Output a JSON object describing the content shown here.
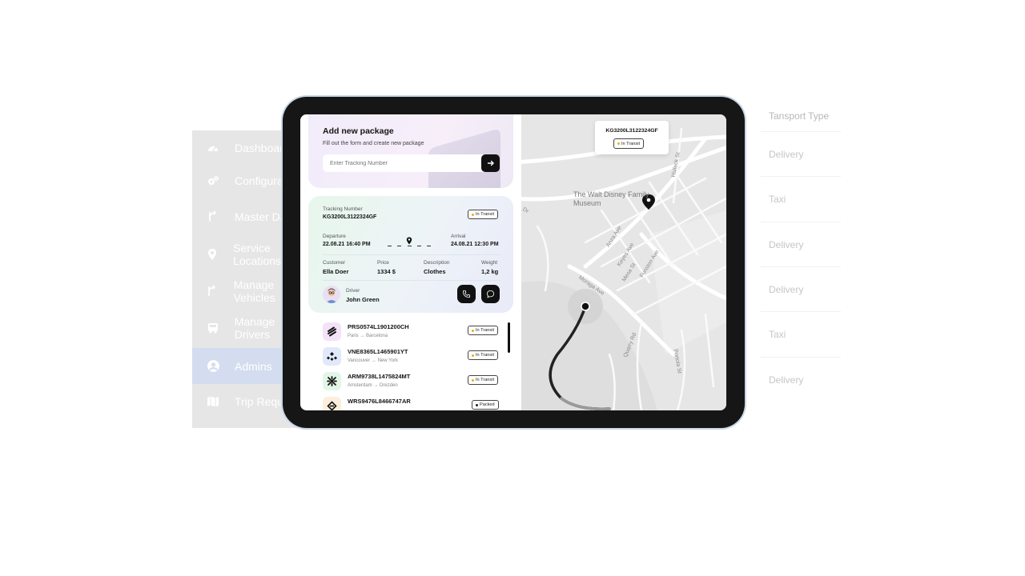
{
  "background": {
    "sidebar": {
      "items": [
        {
          "label": "Dashboard",
          "icon": "gauge-icon"
        },
        {
          "label": "Configurations",
          "icon": "gears-icon"
        },
        {
          "label": "Master Data",
          "icon": "route-icon"
        },
        {
          "label": "Service Locations",
          "icon": "location-pin-icon"
        },
        {
          "label": "Manage Vehicles",
          "icon": "route-icon"
        },
        {
          "label": "Manage Drivers",
          "icon": "bus-icon"
        },
        {
          "label": "Admins",
          "icon": "user-circle-icon",
          "active": true
        },
        {
          "label": "Trip Requests",
          "icon": "map-icon"
        }
      ]
    },
    "table": {
      "header": "Tansport Type",
      "rows": [
        "Delivery",
        "Taxi",
        "Delivery",
        "Delivery",
        "Taxi",
        "Delivery"
      ]
    }
  },
  "app": {
    "add_package": {
      "title": "Add new package",
      "subtitle": "Fill out the form and create new package",
      "placeholder": "Enter Tracking Number"
    },
    "details": {
      "tracking_label": "Tracking Number",
      "tracking_number": "KG3200L3122324GF",
      "status": "In Transit",
      "departure_label": "Departure",
      "departure": "22.08.21 16:40 PM",
      "arrival_label": "Arrival",
      "arrival": "24.08.21 12:30 PM",
      "customer_label": "Customer",
      "customer": "Ella Doer",
      "price_label": "Price",
      "price": "1334 $",
      "description_label": "Description",
      "description": "Clothes",
      "weight_label": "Weight",
      "weight": "1,2 kg",
      "driver_label": "Driver",
      "driver": "John Green"
    },
    "packages": [
      {
        "id": "PRS0574L1901200CH",
        "from": "Paris",
        "to": "Barcelona",
        "status": "In Transit",
        "color": "#f3e2f8",
        "icon": "stripes-icon"
      },
      {
        "id": "VNE8365L1465901YT",
        "from": "Vancouver",
        "to": "New York",
        "status": "In Transit",
        "color": "#e1e8f9",
        "icon": "diamond-dots-icon"
      },
      {
        "id": "ARM9738L1475824MT",
        "from": "Amsterdam",
        "to": "Drezden",
        "status": "In Transit",
        "color": "#e2f6e8",
        "icon": "cross-icon"
      },
      {
        "id": "WRS9476L8466747AR",
        "from": "",
        "to": "",
        "status": "Packed",
        "color": "#fbefdc",
        "icon": "stack-icon"
      }
    ],
    "map": {
      "tracking_number": "KG3200L3122324GF",
      "status": "In Transit",
      "place": "The Walt Disney Family Museum",
      "streets": [
        "Halleck St",
        "Anza Ave",
        "Keyes Ave",
        "Mesa St",
        "Funston Ave",
        "Moraga Ave",
        "Quarry Rd",
        "Portola St",
        "Dr"
      ]
    }
  },
  "colors": {
    "status_dot_transit": "#e4b400",
    "status_dot_packed": "#222222",
    "sidebar_active": "#d3ddef"
  }
}
